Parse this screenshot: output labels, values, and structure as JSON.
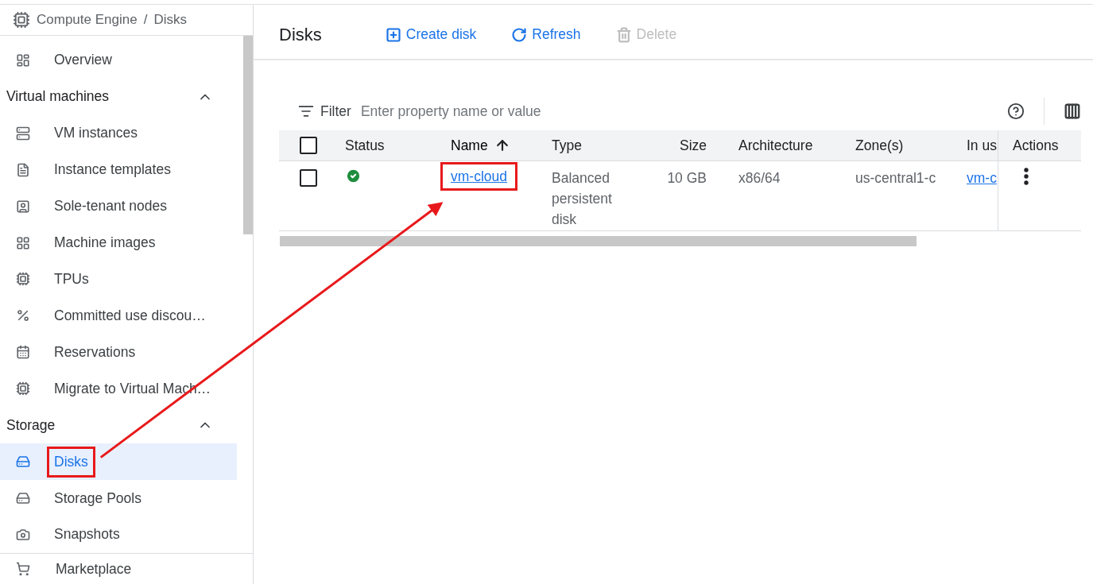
{
  "breadcrumb": {
    "product": "Compute Engine",
    "separator": "/",
    "page": "Disks"
  },
  "sidebar": {
    "items": [
      {
        "kind": "item",
        "label": "Overview",
        "selected": false,
        "highlighted": false
      },
      {
        "kind": "section",
        "label": "Virtual machines",
        "expanded": true
      },
      {
        "kind": "item",
        "label": "VM instances",
        "selected": false,
        "highlighted": false
      },
      {
        "kind": "item",
        "label": "Instance templates",
        "selected": false,
        "highlighted": false
      },
      {
        "kind": "item",
        "label": "Sole-tenant nodes",
        "selected": false,
        "highlighted": false
      },
      {
        "kind": "item",
        "label": "Machine images",
        "selected": false,
        "highlighted": false
      },
      {
        "kind": "item",
        "label": "TPUs",
        "selected": false,
        "highlighted": false
      },
      {
        "kind": "item",
        "label": "Committed use discou…",
        "selected": false,
        "highlighted": false
      },
      {
        "kind": "item",
        "label": "Reservations",
        "selected": false,
        "highlighted": false
      },
      {
        "kind": "item",
        "label": "Migrate to Virtual Mach…",
        "selected": false,
        "highlighted": false
      },
      {
        "kind": "section",
        "label": "Storage",
        "expanded": true
      },
      {
        "kind": "item",
        "label": "Disks",
        "selected": true,
        "highlighted": true
      },
      {
        "kind": "item",
        "label": "Storage Pools",
        "selected": false,
        "highlighted": false
      },
      {
        "kind": "item",
        "label": "Snapshots",
        "selected": false,
        "highlighted": false
      }
    ],
    "footer": {
      "label": "Marketplace"
    }
  },
  "header": {
    "title": "Disks",
    "actions": [
      {
        "kind": "create",
        "label": "Create disk",
        "disabled": false
      },
      {
        "kind": "refresh",
        "label": "Refresh",
        "disabled": false
      },
      {
        "kind": "delete",
        "label": "Delete",
        "disabled": true
      }
    ]
  },
  "filter": {
    "label": "Filter",
    "placeholder": "Enter property name or value"
  },
  "table": {
    "select_all_checked": false,
    "columns": [
      {
        "label": "Status",
        "sorted": false
      },
      {
        "label": "Name",
        "sorted": true
      },
      {
        "label": "Type",
        "sorted": false
      },
      {
        "label": "Size",
        "sorted": false
      },
      {
        "label": "Architecture",
        "sorted": false
      },
      {
        "label": "Zone(s)",
        "sorted": false
      },
      {
        "label": "In us",
        "sorted": false
      },
      {
        "label": "Actions",
        "sorted": false
      }
    ],
    "rows": [
      {
        "checked": false,
        "healthy": true,
        "name": "vm-cloud",
        "name_highlighted": true,
        "type": "Balanced persistent disk",
        "size": "10 GB",
        "architecture": "x86/64",
        "zone": "us-central1-c",
        "in_use": "vm-c"
      }
    ]
  }
}
